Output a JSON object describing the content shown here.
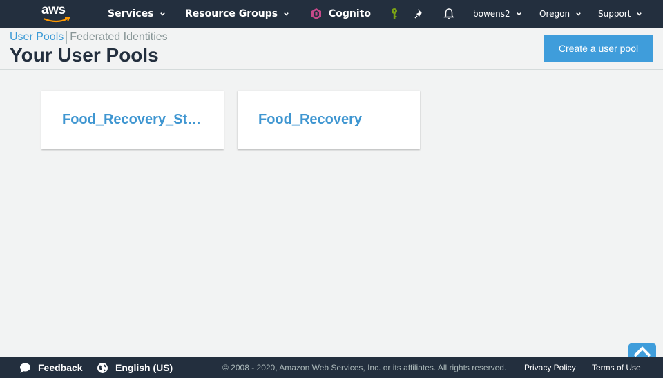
{
  "nav": {
    "logo_text": "aws",
    "services": "Services",
    "resource_groups": "Resource Groups",
    "cognito": "Cognito",
    "user": "bowens2",
    "region": "Oregon",
    "support": "Support"
  },
  "header": {
    "tab_user_pools": "User Pools",
    "tab_federated": "Federated Identities",
    "title": "Your User Pools",
    "create_button": "Create a user pool"
  },
  "pools": [
    {
      "label": "Food_Recovery_Staging"
    },
    {
      "label": "Food_Recovery"
    }
  ],
  "footer": {
    "feedback": "Feedback",
    "language": "English (US)",
    "copyright": "© 2008 - 2020, Amazon Web Services, Inc. or its affiliates. All rights reserved.",
    "privacy": "Privacy Policy",
    "terms": "Terms of Use"
  },
  "colors": {
    "nav_bg": "#232f3e",
    "accent": "#3f9ddb",
    "link": "#3f96d1",
    "page_bg": "#f2f3f3"
  }
}
